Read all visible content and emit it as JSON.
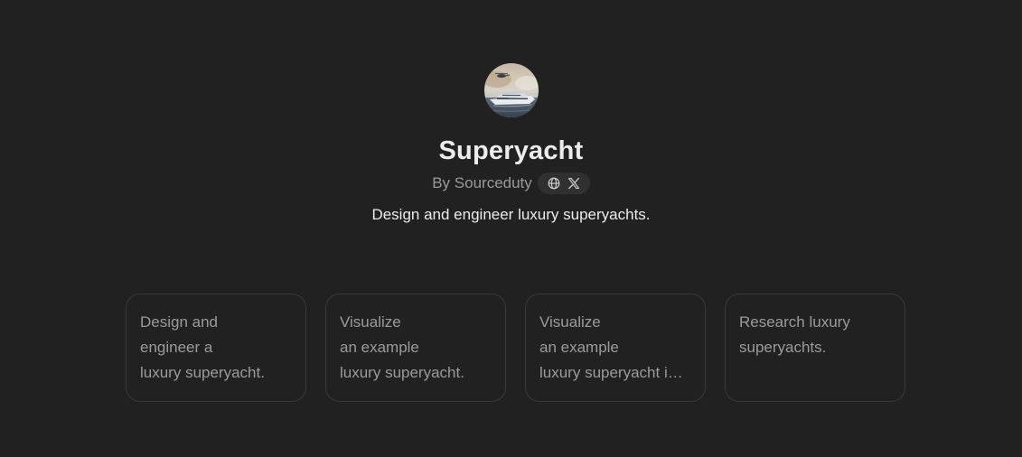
{
  "gpt": {
    "name": "Superyacht",
    "author": "By Sourceduty",
    "description": "Design and engineer luxury superyachts.",
    "links": [
      {
        "icon": "globe-icon"
      },
      {
        "icon": "x-logo-icon"
      }
    ]
  },
  "conversation_starters": [
    {
      "text": "Design and\nengineer a\nluxury superyacht."
    },
    {
      "text": "Visualize\nan example\nluxury superyacht."
    },
    {
      "text": "Visualize\nan example\nluxury superyacht in motion."
    },
    {
      "text": "Research luxury\nsuperyachts."
    }
  ],
  "colors": {
    "background": "#212121",
    "title": "#ececec",
    "muted_text": "#9b9b9b",
    "card_border": "#3a3a3a",
    "pill_background": "#303030"
  }
}
